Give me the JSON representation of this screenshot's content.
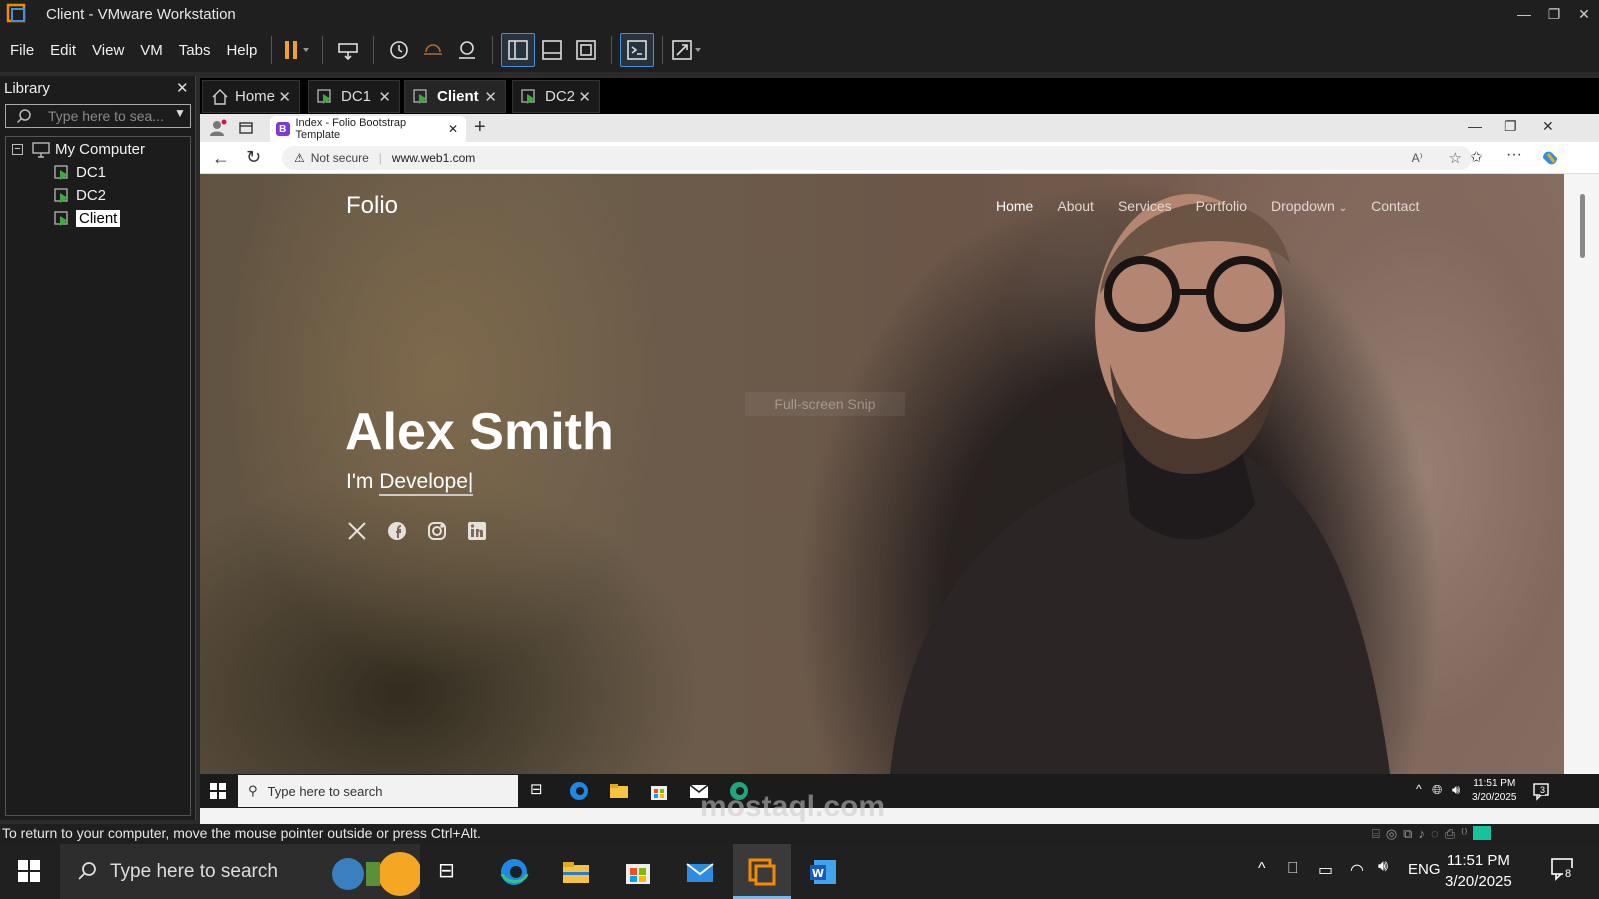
{
  "window": {
    "title": "Client - VMware Workstation"
  },
  "menu": [
    "File",
    "Edit",
    "View",
    "VM",
    "Tabs",
    "Help"
  ],
  "library": {
    "title": "Library",
    "search_placeholder": "Type here to sea...",
    "root": "My Computer",
    "items": [
      "DC1",
      "DC2",
      "Client"
    ]
  },
  "vm_tabs": [
    {
      "label": "Home"
    },
    {
      "label": "DC1"
    },
    {
      "label": "Client"
    },
    {
      "label": "DC2"
    }
  ],
  "browser": {
    "tab_title": "Index - Folio Bootstrap Template",
    "security": "Not secure",
    "url": "www.web1.com"
  },
  "site": {
    "logo": "Folio",
    "nav": [
      "Home",
      "About",
      "Services",
      "Portfolio",
      "Dropdown",
      "Contact"
    ],
    "name": "Alex Smith",
    "sub_prefix": "I'm",
    "sub_typed": "Develope|",
    "social_icons": [
      "x-icon",
      "facebook-icon",
      "instagram-icon",
      "linkedin-icon"
    ],
    "overlay_text": "Full-screen Snip"
  },
  "guest_taskbar": {
    "search": "Type here to search",
    "time": "11:51 PM",
    "date": "3/20/2025",
    "notif_count": "3"
  },
  "status": {
    "text": "To return to your computer, move the mouse pointer outside or press Ctrl+Alt."
  },
  "host_taskbar": {
    "search": "Type here to search",
    "lang": "ENG",
    "time": "11:51 PM",
    "date": "3/20/2025",
    "notif_count": "8"
  },
  "watermark": {
    "text": "mostaql.com"
  },
  "colors": {
    "accent": "#4a90d9",
    "pause": "#f0a030",
    "vmware_orange": "#f38b00"
  }
}
